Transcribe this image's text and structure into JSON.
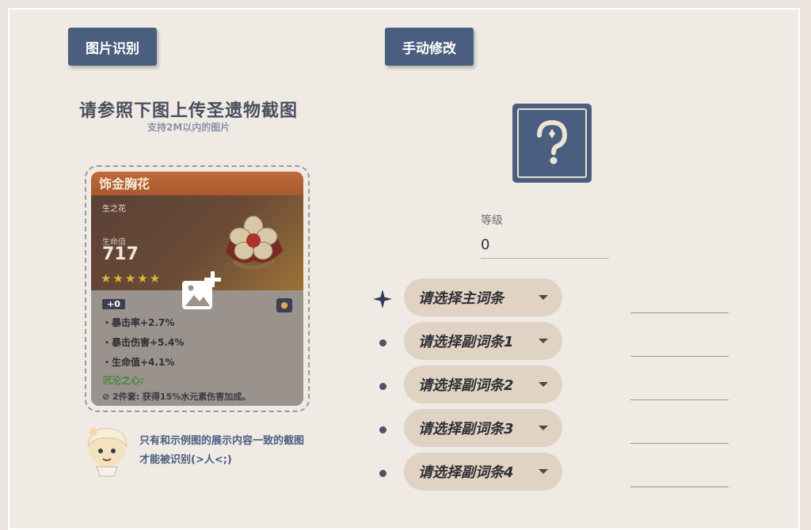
{
  "tabs": {
    "image_recognition": "图片识别",
    "manual_edit": "手动修改"
  },
  "upload": {
    "title": "请参照下图上传圣遗物截图",
    "subtitle": "支持2M以内的图片"
  },
  "example_card": {
    "name": "饰金胸花",
    "type": "生之花",
    "main_stat_name": "生命值",
    "main_stat_value": "717",
    "stars": "★★★★★",
    "level": "+0",
    "substats": [
      "・暴击率+2.7%",
      "・暴击伤害+5.4%",
      "・生命值+4.1%"
    ],
    "set_name": "沉沦之心:",
    "set_effect": "⊘ 2件套: 获得15%水元素伤害加成。"
  },
  "note": {
    "line1": "只有和示例图的展示内容一致的截图",
    "line2": "才能被识别(>人<;)"
  },
  "manual": {
    "level_label": "等级",
    "level_value": "0",
    "main_stat_placeholder": "请选择主词条",
    "sub_stat_placeholders": [
      "请选择副词条1",
      "请选择副词条2",
      "请选择副词条3",
      "请选择副词条4"
    ]
  },
  "colors": {
    "accent": "#4a5f80",
    "pill": "#e0d3c4",
    "background": "#f0eae5"
  }
}
